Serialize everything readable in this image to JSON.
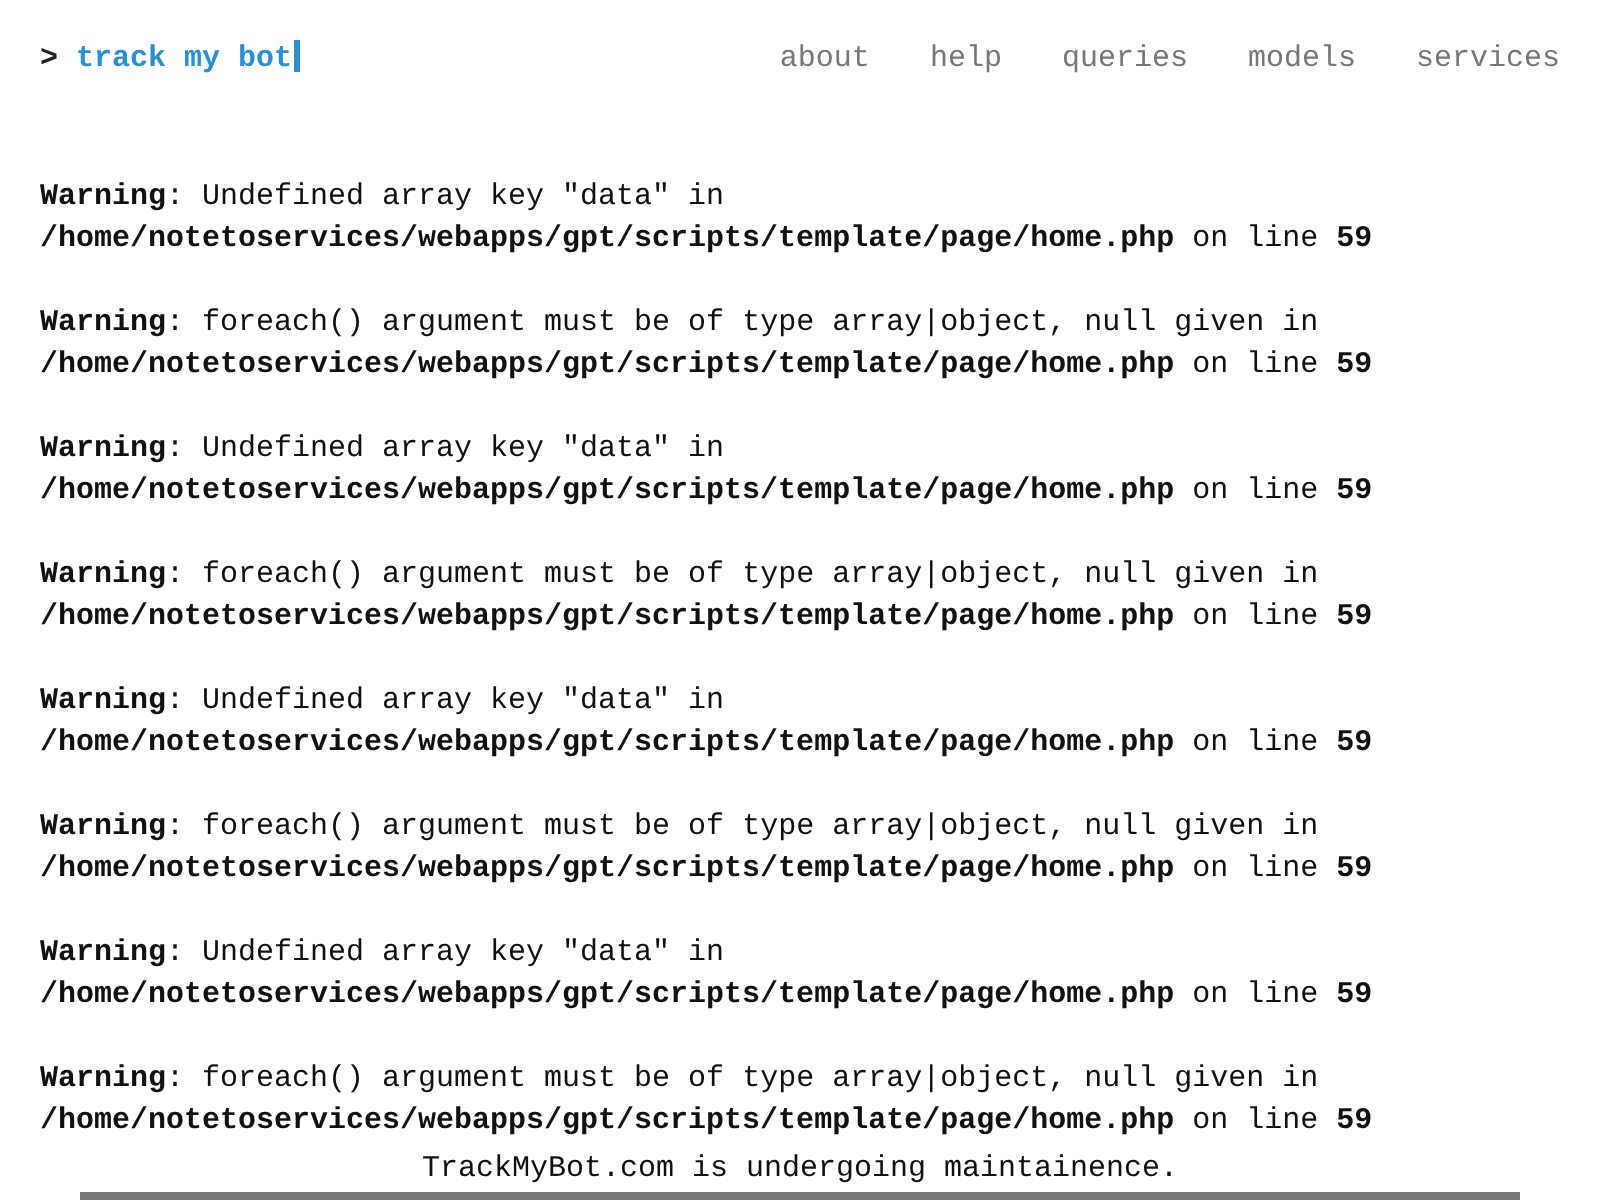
{
  "header": {
    "logo": {
      "prompt": ">",
      "title": "track my bot",
      "cursor": true
    },
    "nav": [
      "about",
      "help",
      "queries",
      "models",
      "services"
    ]
  },
  "warnings": [
    {
      "message": "**Warning**: Undefined array key \"data\" in",
      "location": "**/home/notetoservices/webapps/gpt/scripts/template/page/home.php** on line **59**"
    },
    {
      "message": "**Warning**: foreach() argument must be of type array|object, null given in",
      "location": "**/home/notetoservices/webapps/gpt/scripts/template/page/home.php** on line **59**"
    },
    {
      "message": "**Warning**: Undefined array key \"data\" in",
      "location": "**/home/notetoservices/webapps/gpt/scripts/template/page/home.php** on line **59**"
    },
    {
      "message": "**Warning**: foreach() argument must be of type array|object, null given in",
      "location": "**/home/notetoservices/webapps/gpt/scripts/template/page/home.php** on line **59**"
    },
    {
      "message": "**Warning**: Undefined array key \"data\" in",
      "location": "**/home/notetoservices/webapps/gpt/scripts/template/page/home.php** on line **59**"
    },
    {
      "message": "**Warning**: foreach() argument must be of type array|object, null given in",
      "location": "**/home/notetoservices/webapps/gpt/scripts/template/page/home.php** on line **59**"
    },
    {
      "message": "**Warning**: Undefined array key \"data\" in",
      "location": "**/home/notetoservices/webapps/gpt/scripts/template/page/home.php** on line **59**"
    },
    {
      "message": "**Warning**: foreach() argument must be of type array|object, null given in",
      "location": "**/home/notetoservices/webapps/gpt/scripts/template/page/home.php** on line **59**"
    }
  ],
  "footer": {
    "notice": "TrackMyBot.com is undergoing maintainence."
  }
}
